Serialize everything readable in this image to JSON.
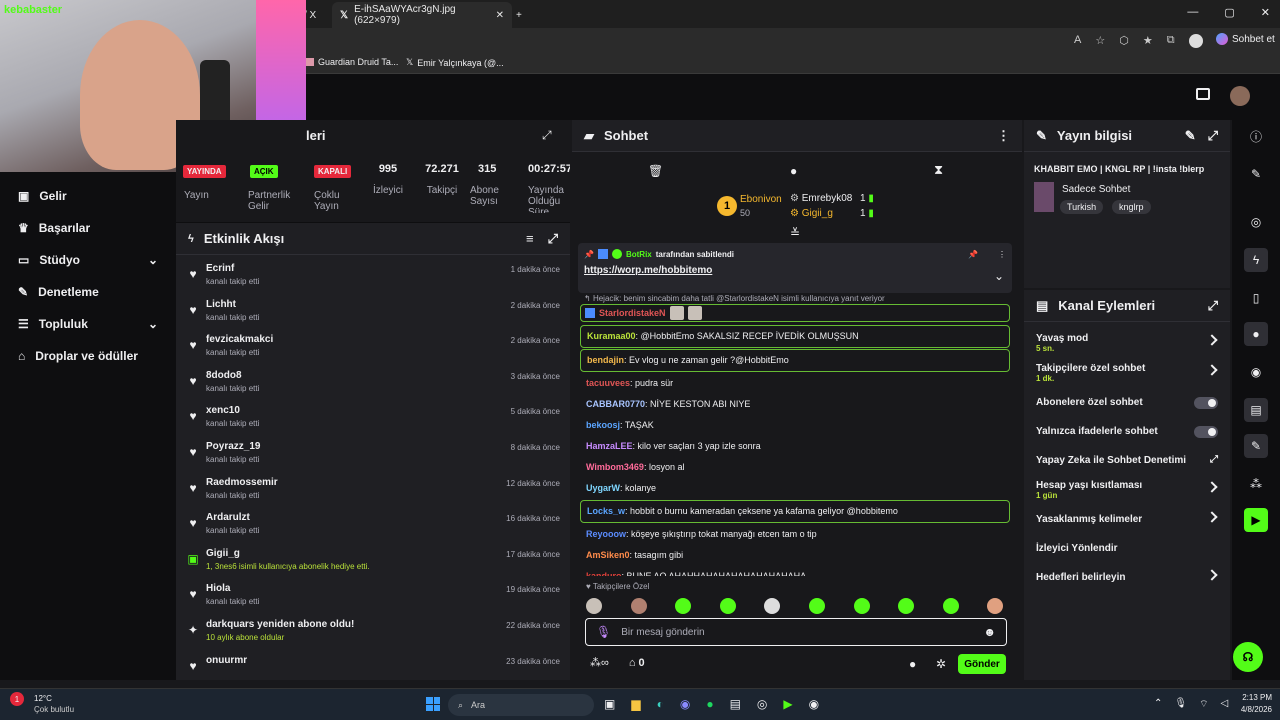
{
  "browser": {
    "tabs": [
      {
        "title": "/ X"
      },
      {
        "title": "E-ihSAaWYAcr3gN.jpg (622×979)"
      }
    ],
    "bookmarks": [
      "Guardian Druid Ta...",
      "Emir Yalçınkaya (@..."
    ],
    "profile_label": "Sohbet et"
  },
  "logo": "kebabaster",
  "stats": [
    {
      "value": "",
      "label": "Yayın",
      "badge": "YAYINDA"
    },
    {
      "value": "",
      "label": "Partnerlik Gelir",
      "badge": "AÇIK"
    },
    {
      "value": "",
      "label": "Çoklu Yayın",
      "badge": "KAPALI"
    },
    {
      "value": "995",
      "label": "İzleyici"
    },
    {
      "value": "72.271",
      "label": "Takipçi"
    },
    {
      "value": "315",
      "label": "Abone Sayısı"
    },
    {
      "value": "00:27:57",
      "label": "Yayında Olduğu Süre"
    }
  ],
  "stats_header": "leri",
  "sidebar": {
    "items": [
      {
        "label": "Gelir",
        "icon": "wallet-icon"
      },
      {
        "label": "Başarılar",
        "icon": "trophy-icon"
      },
      {
        "label": "Stüdyo",
        "icon": "studio-icon"
      },
      {
        "label": "Denetleme",
        "icon": "wrench-icon"
      },
      {
        "label": "Topluluk",
        "icon": "community-icon"
      },
      {
        "label": "Droplar ve ödüller",
        "icon": "gift-icon"
      }
    ]
  },
  "activity": {
    "title": "Etkinlik Akışı",
    "items": [
      {
        "name": "Ecrinf",
        "sub": "kanalı takip etti",
        "time": "1 dakika önce",
        "type": "follow"
      },
      {
        "name": "Lichht",
        "sub": "kanalı takip etti",
        "time": "2 dakika önce",
        "type": "follow"
      },
      {
        "name": "fevzicakmakci",
        "sub": "kanalı takip etti",
        "time": "2 dakika önce",
        "type": "follow"
      },
      {
        "name": "8dodo8",
        "sub": "kanalı takip etti",
        "time": "3 dakika önce",
        "type": "follow"
      },
      {
        "name": "xenc10",
        "sub": "kanalı takip etti",
        "time": "5 dakika önce",
        "type": "follow"
      },
      {
        "name": "Poyrazz_19",
        "sub": "kanalı takip etti",
        "time": "8 dakika önce",
        "type": "follow"
      },
      {
        "name": "Raedmossemir",
        "sub": "kanalı takip etti",
        "time": "12 dakika önce",
        "type": "follow"
      },
      {
        "name": "Ardarulzt",
        "sub": "kanalı takip etti",
        "time": "16 dakika önce",
        "type": "follow"
      },
      {
        "name": "Gigii_g",
        "sub": "1, 3nes6 isimli kullanıcıya abonelik hediye etti.",
        "time": "17 dakika önce",
        "type": "gift"
      },
      {
        "name": "Hiola",
        "sub": "kanalı takip etti",
        "time": "19 dakika önce",
        "type": "follow"
      },
      {
        "name": "darkquars yeniden abone oldu!",
        "sub": "10 aylık abone oldular",
        "time": "22 dakika önce",
        "type": "resub"
      },
      {
        "name": "onuurmr",
        "sub": "",
        "time": "23 dakika önce",
        "type": "follow"
      }
    ]
  },
  "chat": {
    "title": "Sohbet",
    "leaders": [
      {
        "name": "Ebonivon",
        "amount": "50",
        "rank": "1"
      },
      {
        "name": "Emrebyk08",
        "amount": "1"
      },
      {
        "name": "Gigii_g",
        "amount": "1"
      }
    ],
    "pinned": {
      "by": "BotRix",
      "suffix": "tarafından sabitlendi",
      "link": "https://worp.me/hobbitemo"
    },
    "reply_hint": "Hejacik: benim sincabim daha tatli @StarlordistakeN isimli kullanıcıya yanıt veriyor",
    "reply_user": "StarlordistakeN",
    "messages": [
      {
        "user": "Kuramaa00",
        "color": "#bbe33a",
        "text": "@HobbitEmo SAKALSIZ RECEP İVEDİK OLMUŞSUN",
        "hl": true
      },
      {
        "user": "bendajin",
        "color": "#f2b84b",
        "text": "Ev vlog u ne zaman gelir ?@HobbitEmo",
        "hl": true
      },
      {
        "user": "tacuuvees",
        "color": "#e05555",
        "text": "pudra sür",
        "hl": false
      },
      {
        "user": "CABBAR0770",
        "color": "#a8c4ff",
        "text": "NİYE KESTON ABI NIYE",
        "hl": false
      },
      {
        "user": "bekoosj",
        "color": "#5ba5ff",
        "text": "TAŞAK",
        "hl": false
      },
      {
        "user": "HamzaLEE",
        "color": "#c78bff",
        "text": "kilo ver saçları 3 yap izle sonra",
        "hl": false
      },
      {
        "user": "Wimbom3469",
        "color": "#ff6b9a",
        "text": "losyon al",
        "hl": false
      },
      {
        "user": "UygarW",
        "color": "#7fd6ff",
        "text": "kolanye",
        "hl": false
      },
      {
        "user": "Locks_w",
        "color": "#5ba5ff",
        "text": "hobbit o burnu kameradan çeksene ya kafama geliyor @hobbitemo",
        "hl": true
      },
      {
        "user": "Reyooow",
        "color": "#5b8cff",
        "text": "köşeye şıkıştırıp tokat manyağı etcen tam o tip",
        "hl": false
      },
      {
        "user": "AmSiken0",
        "color": "#ff8c4b",
        "text": "tasagım gibi",
        "hl": false
      },
      {
        "user": "kanduro",
        "color": "#e0403a",
        "text": "BUNE AQ AHAHHAHAHAHAHAHAHAHAHA",
        "hl": false
      }
    ],
    "followers_only": "Takipçilere Özel",
    "placeholder": "Bir mesaj gönderin",
    "send": "Gönder",
    "points": "0"
  },
  "stream_info": {
    "title": "Yayın bilgisi",
    "stream_title": "KHABBIT EMO | KNGL RP | !insta !blerp",
    "category": "Sadece Sohbet",
    "tags": [
      "Turkish",
      "knglrp"
    ]
  },
  "channel_actions": {
    "title": "Kanal Eylemleri",
    "items": [
      {
        "label": "Yavaş mod",
        "sub": "5 sn.",
        "kind": "chevron"
      },
      {
        "label": "Takipçilere özel sohbet",
        "sub": "1 dk.",
        "kind": "chevron"
      },
      {
        "label": "Abonelere özel sohbet",
        "sub": "",
        "kind": "toggle"
      },
      {
        "label": "Yalnızca ifadelerle sohbet",
        "sub": "",
        "kind": "toggle"
      },
      {
        "label": "Yapay Zeka ile Sohbet Denetimi",
        "sub": "",
        "kind": "external"
      },
      {
        "label": "Hesap yaşı kısıtlaması",
        "sub": "1 gün",
        "kind": "chevron"
      },
      {
        "label": "Yasaklanmış kelimeler",
        "sub": "",
        "kind": "chevron"
      },
      {
        "label": "İzleyici Yönlendir",
        "sub": "",
        "kind": "none"
      },
      {
        "label": "Hedefleri belirleyin",
        "sub": "",
        "kind": "chevron"
      }
    ]
  },
  "taskbar": {
    "weather_temp": "12°C",
    "weather_desc": "Çok bulutlu",
    "search": "Ara",
    "time": "2:13 PM",
    "date": "4/8/2026"
  },
  "colors": {
    "accent": "#53fc18",
    "bg": "#18181b",
    "panel": "#1f1f23"
  }
}
